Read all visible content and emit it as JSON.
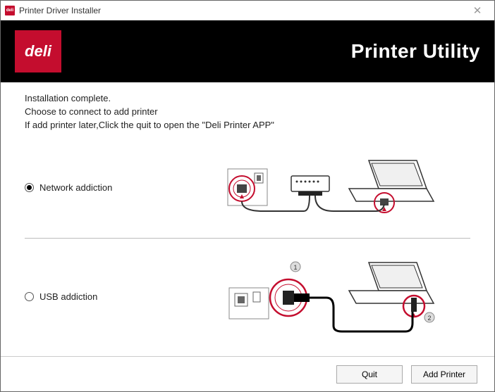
{
  "window": {
    "title": "Printer Driver Installer",
    "app_icon_text": "deli"
  },
  "banner": {
    "logo_text": "deli",
    "utility_title": "Printer Utility"
  },
  "message": {
    "line1": "Installation complete.",
    "line2": " Choose to connect to add printer",
    "line3": "If add printer later,Click the quit to open the \"Deli Printer APP\""
  },
  "options": {
    "network": {
      "label": "Network addiction",
      "selected": true,
      "icon": "network-diagram-icon"
    },
    "usb": {
      "label": "USB addiction",
      "selected": false,
      "icon": "usb-diagram-icon"
    }
  },
  "footer": {
    "quit_label": "Quit",
    "add_label": "Add Printer"
  },
  "colors": {
    "brand_red": "#c40d2e",
    "banner_bg": "#000000"
  }
}
